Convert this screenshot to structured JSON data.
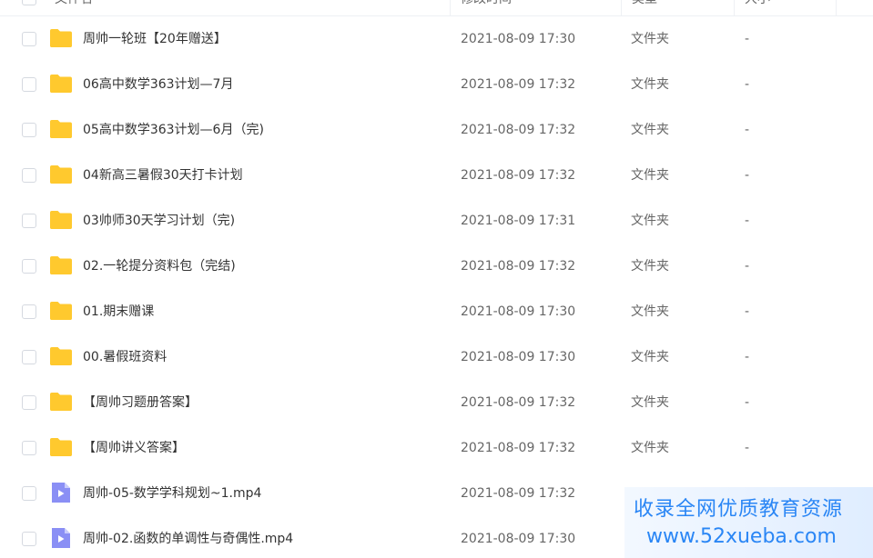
{
  "header": {
    "col_name": "文件名",
    "col_time": "修改时间",
    "col_type": "类型",
    "col_size": "大小"
  },
  "files": [
    {
      "name": "周帅一轮班【20年赠送】",
      "time": "2021-08-09 17:30",
      "type": "文件夹",
      "size": "-",
      "icon": "folder-icon"
    },
    {
      "name": "06高中数学363计划—7月",
      "time": "2021-08-09 17:32",
      "type": "文件夹",
      "size": "-",
      "icon": "folder-icon"
    },
    {
      "name": "05高中数学363计划—6月（完)",
      "time": "2021-08-09 17:32",
      "type": "文件夹",
      "size": "-",
      "icon": "folder-icon"
    },
    {
      "name": "04新高三暑假30天打卡计划",
      "time": "2021-08-09 17:32",
      "type": "文件夹",
      "size": "-",
      "icon": "folder-icon"
    },
    {
      "name": "03帅师30天学习计划（完)",
      "time": "2021-08-09 17:31",
      "type": "文件夹",
      "size": "-",
      "icon": "folder-icon"
    },
    {
      "name": "02.一轮提分资料包（完结)",
      "time": "2021-08-09 17:32",
      "type": "文件夹",
      "size": "-",
      "icon": "folder-icon"
    },
    {
      "name": "01.期末赠课",
      "time": "2021-08-09 17:30",
      "type": "文件夹",
      "size": "-",
      "icon": "folder-icon"
    },
    {
      "name": "00.暑假班资料",
      "time": "2021-08-09 17:30",
      "type": "文件夹",
      "size": "-",
      "icon": "folder-icon"
    },
    {
      "name": "【周帅习题册答案】",
      "time": "2021-08-09 17:32",
      "type": "文件夹",
      "size": "-",
      "icon": "folder-icon"
    },
    {
      "name": "【周帅讲义答案】",
      "time": "2021-08-09 17:32",
      "type": "文件夹",
      "size": "-",
      "icon": "folder-icon"
    },
    {
      "name": "周帅-05-数学学科规划~1.mp4",
      "time": "2021-08-09 17:32",
      "type": "",
      "size": "",
      "icon": "video-file-icon"
    },
    {
      "name": "周帅-02.函数的单调性与奇偶性.mp4",
      "time": "2021-08-09 17:30",
      "type": "",
      "size": "",
      "icon": "video-file-icon"
    }
  ],
  "watermark": {
    "line1": "收录全网优质教育资源",
    "line2": "www.52xueba.com"
  },
  "colors": {
    "folder": "#ffc92e",
    "video": "#8a8ff5",
    "accent": "#2a86f5"
  }
}
